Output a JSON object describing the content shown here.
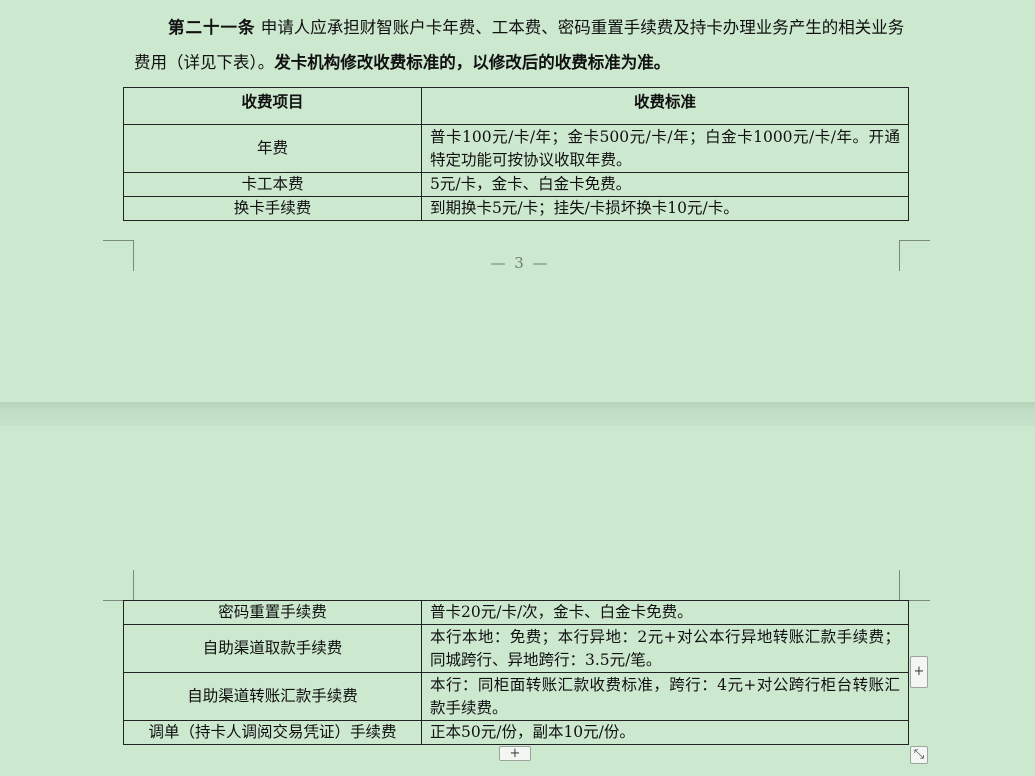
{
  "article": {
    "number": "第二十一条",
    "text": "申请人应承担财智账户卡年费、工本费、密码重置手续费及持卡办理业务产生的相关业务费用（详见下表）。",
    "bold_text": "发卡机构修改收费标准的，以修改后的收费标准为准。"
  },
  "table": {
    "headers": [
      "收费项目",
      "收费标准"
    ],
    "rows_page1": [
      {
        "item": "年费",
        "standard": "普卡100元/卡/年；金卡500元/卡/年；白金卡1000元/卡/年。开通特定功能可按协议收取年费。"
      },
      {
        "item": "卡工本费",
        "standard": "5元/卡，金卡、白金卡免费。"
      },
      {
        "item": "换卡手续费",
        "standard": "到期换卡5元/卡；挂失/卡损坏换卡10元/卡。"
      }
    ],
    "rows_page2": [
      {
        "item": "密码重置手续费",
        "standard": "普卡20元/卡/次，金卡、白金卡免费。"
      },
      {
        "item": "自助渠道取款手续费",
        "standard": "本行本地：免费；本行异地：2元+对公本行异地转账汇款手续费；同城跨行、异地跨行：3.5元/笔。"
      },
      {
        "item": "自助渠道转账汇款手续费",
        "standard": "本行：同柜面转账汇款收费标准，跨行：4元+对公跨行柜台转账汇款手续费。"
      },
      {
        "item": "调单（持卡人调阅交易凭证）手续费",
        "standard": "正本50元/份，副本10元/份。"
      }
    ]
  },
  "page_number": "— 3 —",
  "controls": {
    "add_row": "+",
    "add_column": "+",
    "resize": "⤡"
  }
}
